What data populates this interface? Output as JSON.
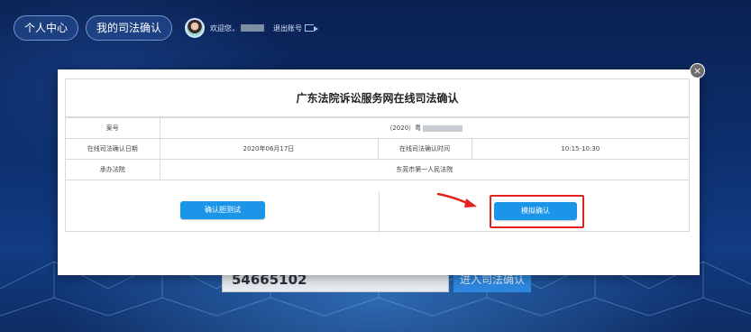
{
  "nav": {
    "personal_center": "个人中心",
    "my_judicial_confirm": "我的司法确认",
    "welcome": "欢迎您，",
    "logout": "退出账号"
  },
  "background_form": {
    "case_number_partial": "54665102",
    "enter_button": "进入司法确认"
  },
  "modal": {
    "title": "广东法院诉讼服务网在线司法确认",
    "rows": [
      {
        "label": "案号",
        "value": "（2020）粤"
      },
      {
        "label": "在线司法确认日期",
        "value": "2020年06月17日",
        "label2": "在线司法确认时间",
        "value2": "10:15-10:30"
      },
      {
        "label": "承办法院",
        "value": "东莞市第一人民法院"
      }
    ],
    "confirm_test_button": "确认胆测试",
    "simulate_confirm_button": "模拟确认",
    "close": "×"
  },
  "colors": {
    "primary_button": "#1b95e8",
    "highlight": "#e0231e",
    "background": "#0b2a63"
  }
}
